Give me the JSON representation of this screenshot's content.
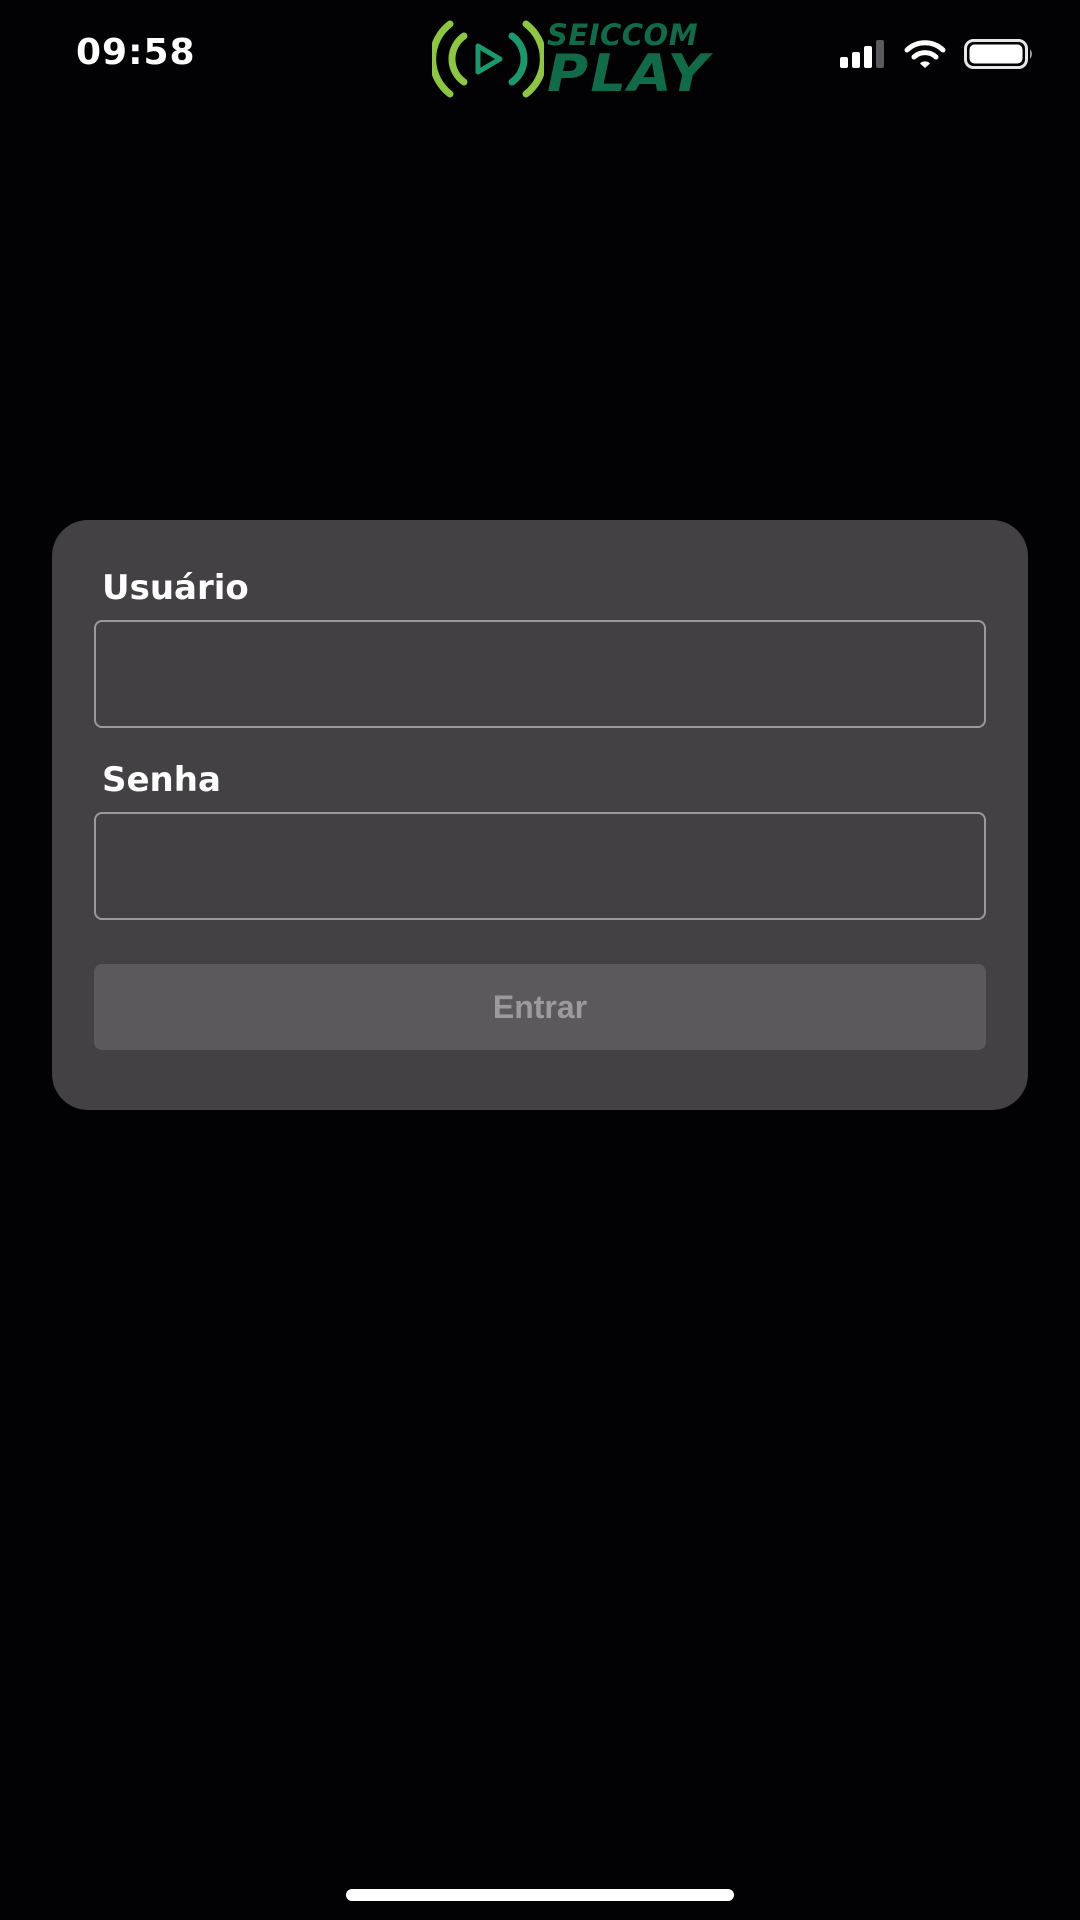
{
  "status_bar": {
    "time": "09:58",
    "icons": [
      "cellular-signal-icon",
      "wifi-icon",
      "battery-icon"
    ]
  },
  "logo": {
    "line1": "SEICCOM",
    "line2": "PLAY",
    "colors": {
      "waves": "#8dc63f",
      "play": "#1a9a6c",
      "text": "#0f6b48"
    }
  },
  "login_form": {
    "username_label": "Usuário",
    "username_value": "",
    "password_label": "Senha",
    "password_value": "",
    "submit_label": "Entrar"
  },
  "colors": {
    "background": "#020103",
    "card": "#434144",
    "input_border": "#9b999c",
    "button": "#5b595c",
    "button_text": "#9c9a9d"
  }
}
